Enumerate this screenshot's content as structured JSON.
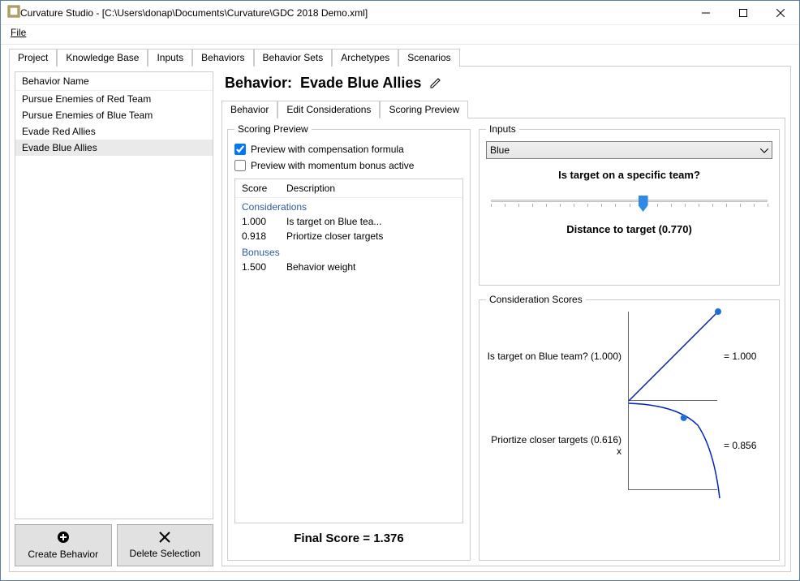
{
  "window": {
    "title": "Curvature Studio - [C:\\Users\\donap\\Documents\\Curvature\\GDC 2018 Demo.xml]"
  },
  "menu": {
    "file": "File"
  },
  "tabs": [
    "Project",
    "Knowledge Base",
    "Inputs",
    "Behaviors",
    "Behavior Sets",
    "Archetypes",
    "Scenarios"
  ],
  "tabs_active_index": 3,
  "behavior_list": {
    "header": "Behavior Name",
    "items": [
      "Pursue Enemies of Red Team",
      "Pursue Enemies of Blue Team",
      "Evade Red Allies",
      "Evade Blue Allies"
    ],
    "selected_index": 3
  },
  "buttons": {
    "create": "Create Behavior",
    "delete": "Delete Selection"
  },
  "behavior": {
    "label": "Behavior:",
    "name": "Evade Blue Allies"
  },
  "subtabs": [
    "Behavior",
    "Edit Considerations",
    "Scoring Preview"
  ],
  "subtabs_active_index": 2,
  "scoring_preview": {
    "legend": "Scoring Preview",
    "check1": "Preview with compensation formula",
    "check1_checked": true,
    "check2": "Preview with momentum bonus active",
    "check2_checked": false,
    "table": {
      "col_score": "Score",
      "col_desc": "Description",
      "section1": "Considerations",
      "rows1": [
        {
          "score": "1.000",
          "desc": "Is target on Blue tea..."
        },
        {
          "score": "0.918",
          "desc": "Priortize closer targets"
        }
      ],
      "section2": "Bonuses",
      "rows2": [
        {
          "score": "1.500",
          "desc": "Behavior weight"
        }
      ]
    },
    "final_score": "Final Score = 1.376"
  },
  "inputs_panel": {
    "legend": "Inputs",
    "dropdown_value": "Blue",
    "question1": "Is target on a specific team?",
    "slider_value": 0.55,
    "question2": "Distance to target (0.770)"
  },
  "consideration_scores": {
    "legend": "Consideration Scores",
    "rows": [
      {
        "label": "Is target on Blue team? (1.000)",
        "value": "= 1.000",
        "curve": "linear",
        "point_x": 1.0,
        "point_y": 1.0
      },
      {
        "label": "Priortize closer targets (0.616) x",
        "value": "= 0.856",
        "curve": "inverse",
        "point_x": 0.616,
        "point_y": 0.81
      }
    ]
  },
  "chart_data": [
    {
      "type": "line",
      "title": "Is target on Blue team?",
      "x": [
        0,
        1
      ],
      "y": [
        0,
        1
      ],
      "marker": {
        "x": 1.0,
        "y": 1.0
      },
      "result": 1.0
    },
    {
      "type": "line",
      "title": "Priortize closer targets",
      "x": [
        0,
        0.1,
        0.2,
        0.3,
        0.4,
        0.5,
        0.6,
        0.7,
        0.8,
        0.9,
        1.0
      ],
      "y": [
        1.0,
        0.99,
        0.98,
        0.96,
        0.93,
        0.88,
        0.81,
        0.7,
        0.54,
        0.3,
        -0.1
      ],
      "marker": {
        "x": 0.616,
        "y": 0.81
      },
      "result": 0.856
    }
  ]
}
